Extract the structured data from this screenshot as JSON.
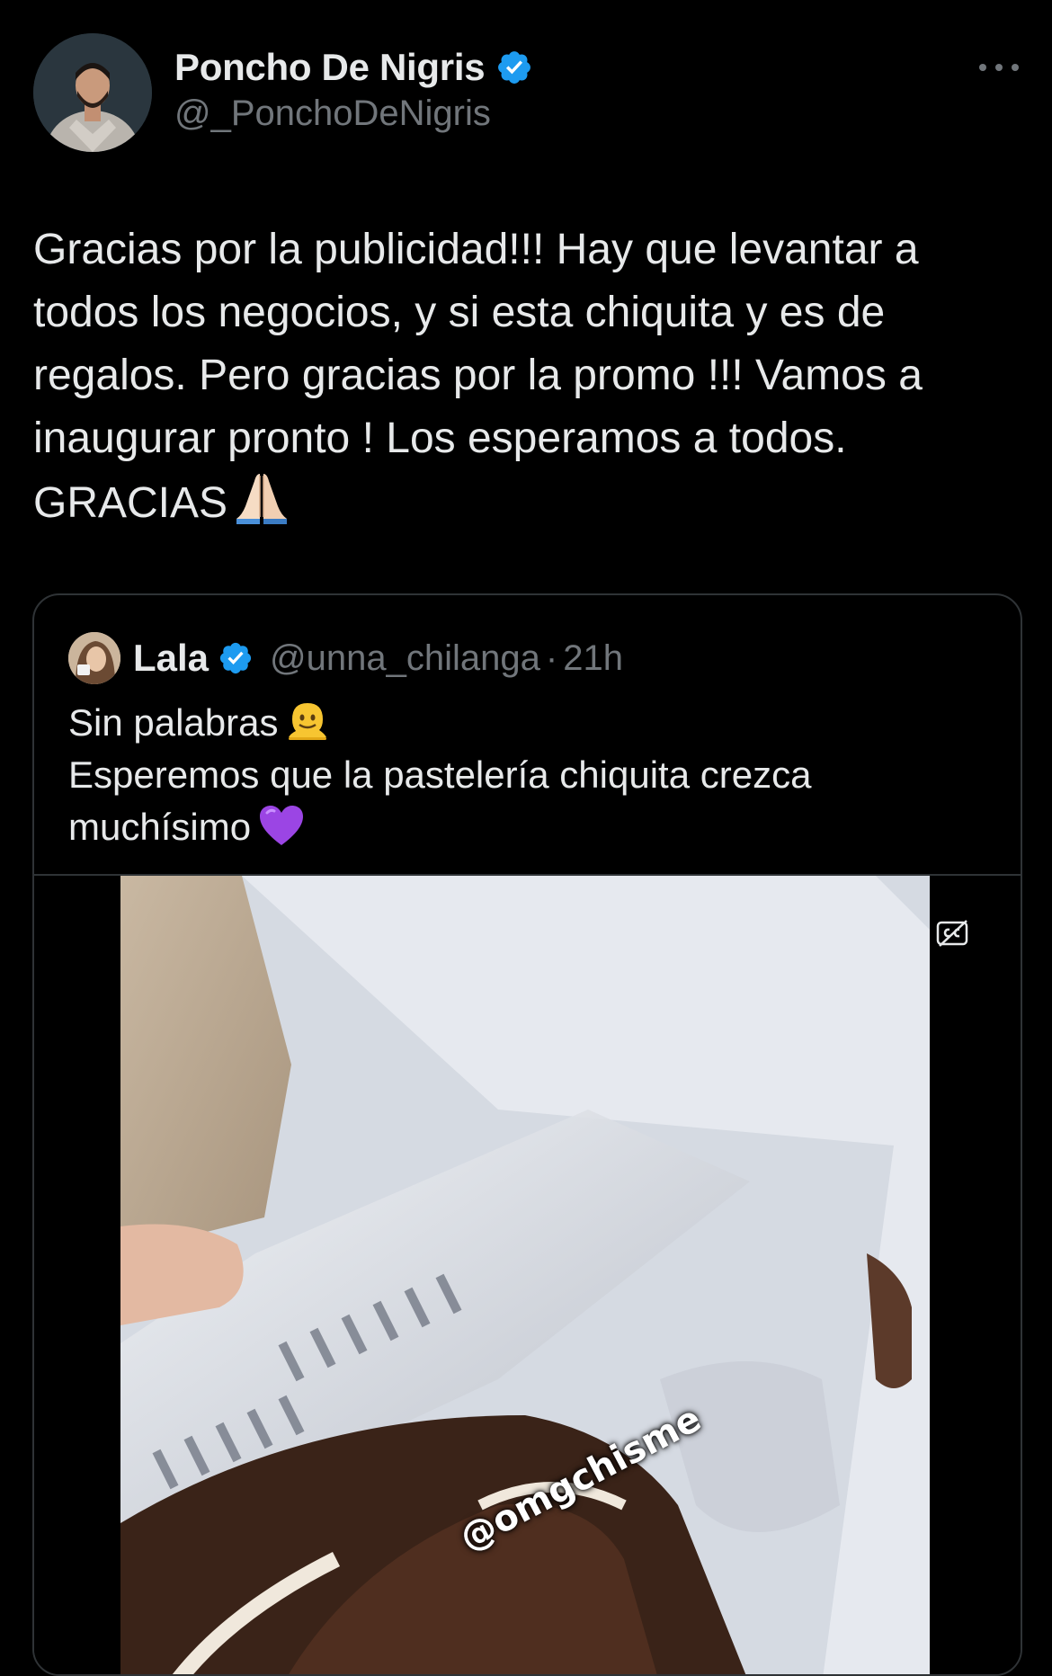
{
  "author": {
    "name": "Poncho De Nigris",
    "handle": "@_PonchoDeNigris",
    "verified": true
  },
  "tweet": {
    "text_lines": [
      "Gracias por la publicidad!!! Hay que levantar a",
      "todos los negocios, y si esta chiquita y es de",
      "regalos. Pero gracias por la promo !!! Vamos a",
      "inaugurar pronto ! Los esperamos a todos.",
      "GRACIAS"
    ]
  },
  "quoted_tweet": {
    "name": "Lala",
    "handle": "@unna_chilanga",
    "separator": "·",
    "time": "21h",
    "verified": true,
    "text_lines": [
      "Sin palabras",
      "Esperemos que la pastelería chiquita crezca",
      "muchísimo"
    ],
    "media": {
      "watermark": "@omgchisme"
    }
  },
  "colors": {
    "background": "#000000",
    "text": "#e7e9ea",
    "secondary_text": "#71767b",
    "verified_blue": "#1d9bf0",
    "border": "#2f3336"
  },
  "icons": {
    "more": "more-icon",
    "verified": "verified-badge-icon",
    "captions": "closed-captions-icon",
    "pray_emoji": "folded-hands-emoji",
    "melting_emoji": "melting-face-emoji",
    "heart_emoji": "purple-heart-emoji"
  }
}
